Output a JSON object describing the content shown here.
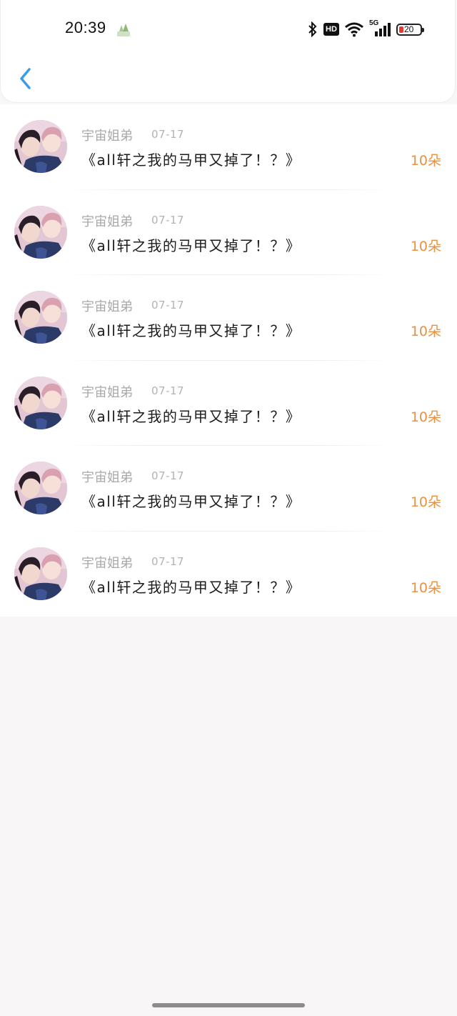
{
  "status_bar": {
    "time": "20:39",
    "network": "5G",
    "hd": "HD",
    "battery": "20"
  },
  "header": {
    "back_icon": "chevron-left-icon",
    "accent_color": "#3a9ee4"
  },
  "gifts": [
    {
      "name": "宇宙姐弟",
      "date": "07-17",
      "title": "《all轩之我的马甲又掉了！？》",
      "amount": "10朵"
    },
    {
      "name": "宇宙姐弟",
      "date": "07-17",
      "title": "《all轩之我的马甲又掉了！？》",
      "amount": "10朵"
    },
    {
      "name": "宇宙姐弟",
      "date": "07-17",
      "title": "《all轩之我的马甲又掉了！？》",
      "amount": "10朵"
    },
    {
      "name": "宇宙姐弟",
      "date": "07-17",
      "title": "《all轩之我的马甲又掉了！？》",
      "amount": "10朵"
    },
    {
      "name": "宇宙姐弟",
      "date": "07-17",
      "title": "《all轩之我的马甲又掉了！？》",
      "amount": "10朵"
    },
    {
      "name": "宇宙姐弟",
      "date": "07-17",
      "title": "《all轩之我的马甲又掉了！？》",
      "amount": "10朵"
    }
  ],
  "colors": {
    "amount": "#e8923f",
    "name": "#a8a8a8",
    "title": "#1c1c1c"
  }
}
